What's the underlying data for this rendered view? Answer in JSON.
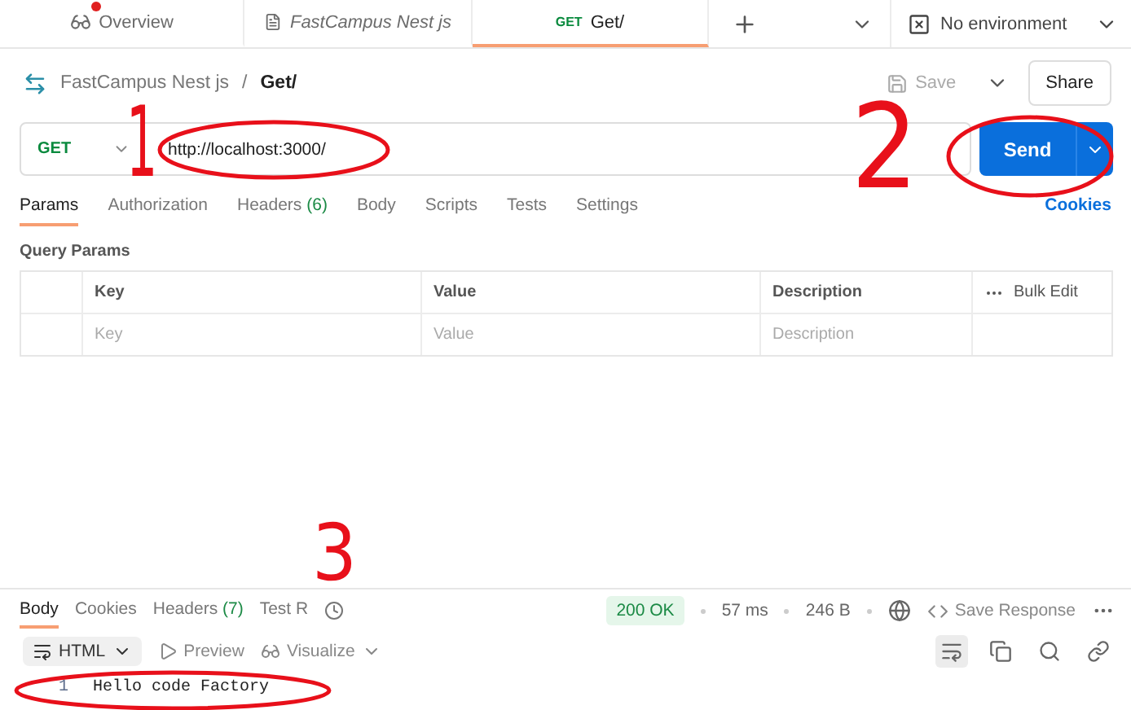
{
  "top_tabs": [
    {
      "kind": "overview",
      "label": "Overview",
      "selected": false,
      "unsaved": true
    },
    {
      "kind": "collection",
      "label": "FastCampus Nest js",
      "selected": false
    },
    {
      "kind": "request",
      "method": "GET",
      "label": "Get/",
      "selected": true
    }
  ],
  "environment": "No environment",
  "breadcrumb": {
    "collection": "FastCampus Nest js",
    "separator": "/",
    "request": "Get/"
  },
  "save_label": "Save",
  "share_label": "Share",
  "request": {
    "method": "GET",
    "url": "http://localhost:3000/",
    "send_label": "Send"
  },
  "request_tabs": [
    {
      "label": "Params",
      "selected": true
    },
    {
      "label": "Authorization",
      "selected": false
    },
    {
      "label": "Headers",
      "count": "(6)",
      "selected": false
    },
    {
      "label": "Body",
      "selected": false
    },
    {
      "label": "Scripts",
      "selected": false
    },
    {
      "label": "Tests",
      "selected": false
    },
    {
      "label": "Settings",
      "selected": false
    }
  ],
  "cookies_link": "Cookies",
  "query_params": {
    "title": "Query Params",
    "columns": [
      "Key",
      "Value",
      "Description"
    ],
    "bulk_edit": "Bulk Edit",
    "placeholders": [
      "Key",
      "Value",
      "Description"
    ]
  },
  "response_tabs": [
    {
      "label": "Body",
      "selected": true
    },
    {
      "label": "Cookies",
      "selected": false
    },
    {
      "label": "Headers",
      "count": "(7)",
      "selected": false
    },
    {
      "label": "Test R",
      "selected": false
    }
  ],
  "status": "200 OK",
  "time": "57 ms",
  "size": "246 B",
  "save_response": "Save Response",
  "format": "HTML",
  "preview": "Preview",
  "visualize": "Visualize",
  "code_lines": [
    {
      "number": "1",
      "text": "Hello code Factory"
    }
  ],
  "annotations": [
    {
      "label": "1"
    },
    {
      "label": "2"
    },
    {
      "label": "3"
    }
  ]
}
